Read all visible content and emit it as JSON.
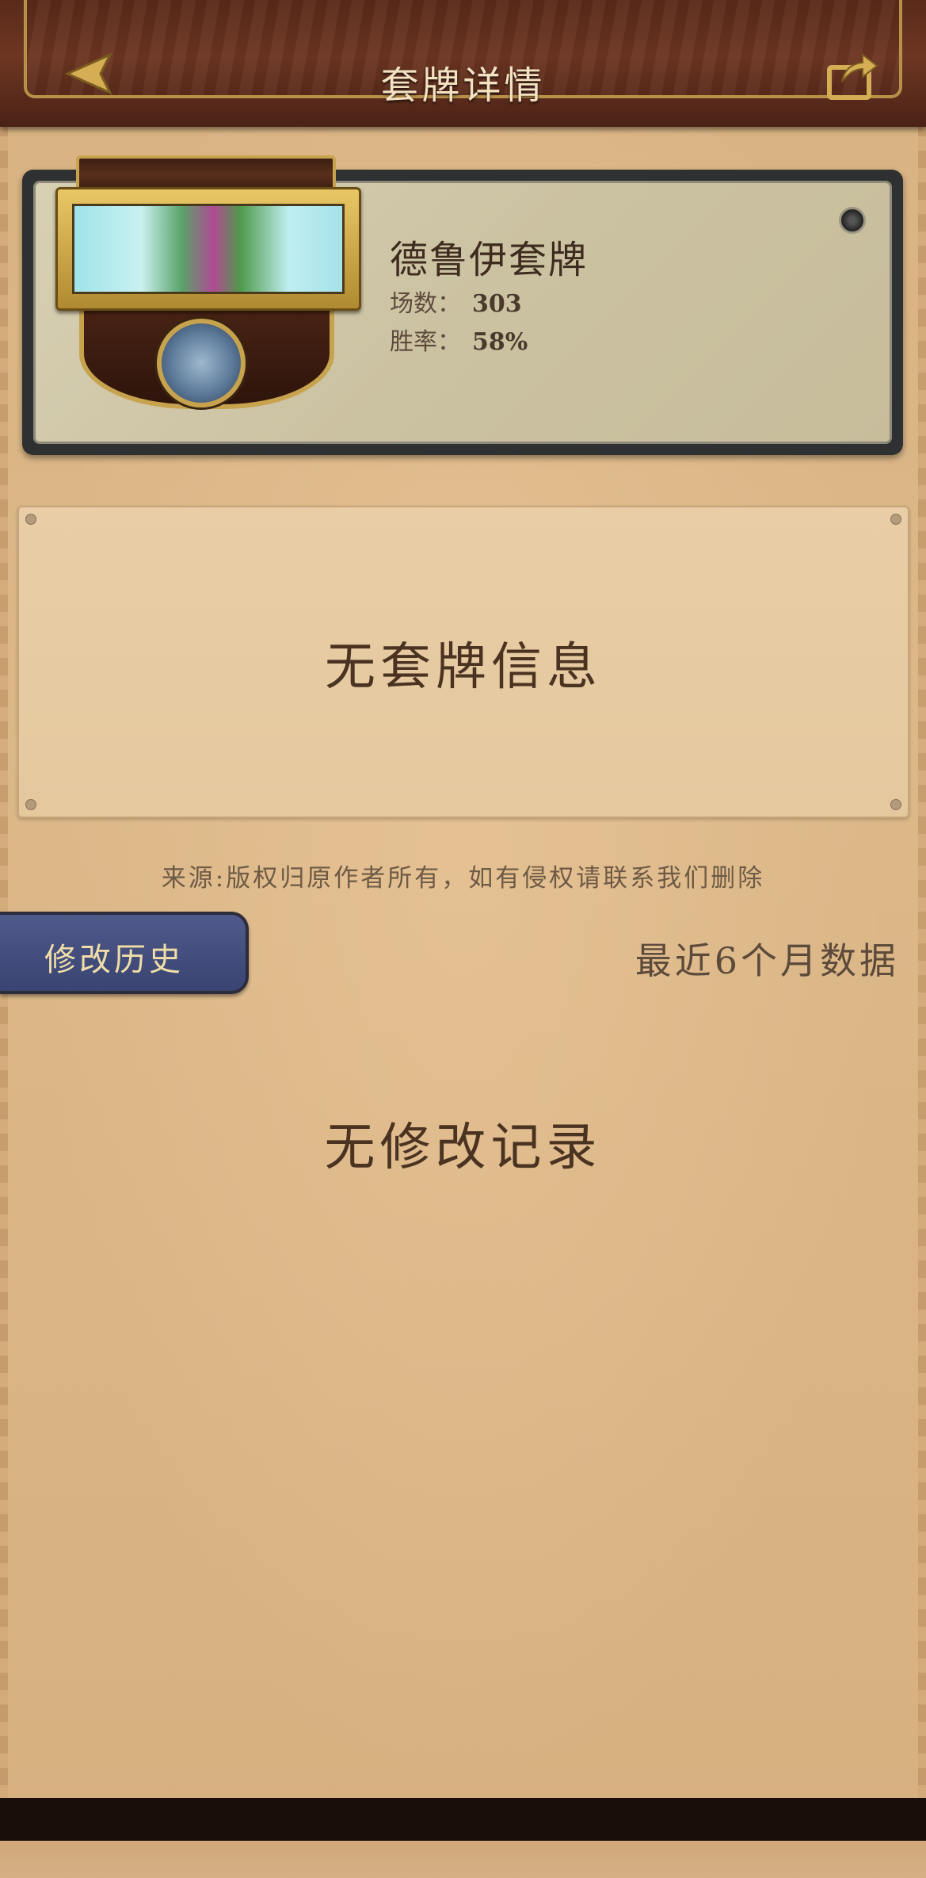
{
  "header": {
    "title": "套牌详情",
    "back_icon": "back-arrow-icon",
    "share_icon": "share-icon"
  },
  "deck": {
    "name": "德鲁伊套牌",
    "games_label": "场数：",
    "games_value": "303",
    "winrate_label": "胜率：",
    "winrate_value": "58%"
  },
  "deck_info": {
    "empty_text": "无套牌信息"
  },
  "source_note": "来源:版权归原作者所有，如有侵权请联系我们删除",
  "history": {
    "tab_label": "修改历史",
    "period_label": "最近6个月数据",
    "empty_text": "无修改记录"
  },
  "colors": {
    "header_bg": "#5a2a1a",
    "gold_accent": "#c7a34e",
    "parchment": "#d9b487",
    "tab_blue": "#4f5a8c"
  }
}
